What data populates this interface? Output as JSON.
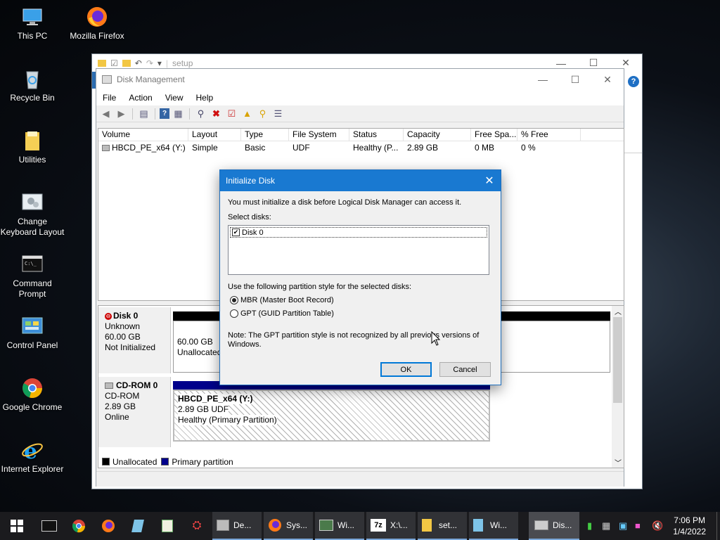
{
  "desktop": {
    "icons": [
      {
        "label": "This PC",
        "icon": "this-pc-icon"
      },
      {
        "label": "Mozilla Firefox",
        "icon": "firefox-icon"
      },
      {
        "label": "Recycle Bin",
        "icon": "recycle-bin-icon"
      },
      {
        "label": "Utilities",
        "icon": "folder-icon"
      },
      {
        "label": "Change Keyboard Layout",
        "icon": "keyboard-settings-icon"
      },
      {
        "label": "Command Prompt",
        "icon": "cmd-icon"
      },
      {
        "label": "Control Panel",
        "icon": "control-panel-icon"
      },
      {
        "label": "Google Chrome",
        "icon": "chrome-icon"
      },
      {
        "label": "Internet Explorer",
        "icon": "ie-icon"
      }
    ]
  },
  "explorer": {
    "path": "setup"
  },
  "disk_mgmt": {
    "title": "Disk Management",
    "menu": [
      "File",
      "Action",
      "View",
      "Help"
    ],
    "columns": [
      "Volume",
      "Layout",
      "Type",
      "File System",
      "Status",
      "Capacity",
      "Free Spa...",
      "% Free"
    ],
    "rows": [
      {
        "volume": "HBCD_PE_x64 (Y:)",
        "layout": "Simple",
        "type": "Basic",
        "fs": "UDF",
        "status": "Healthy (P...",
        "capacity": "2.89 GB",
        "free": "0 MB",
        "pct": "0 %"
      }
    ],
    "disks": [
      {
        "name": "Disk 0",
        "kind": "Unknown",
        "size": "60.00 GB",
        "state": "Not Initialized",
        "part_size": "60.00 GB",
        "part_state": "Unallocated"
      },
      {
        "name": "CD-ROM 0",
        "kind": "CD-ROM",
        "size": "2.89 GB",
        "state": "Online",
        "part_name": "HBCD_PE_x64  (Y:)",
        "part_size": "2.89 GB UDF",
        "part_state": "Healthy (Primary Partition)"
      }
    ],
    "legend": [
      "Unallocated",
      "Primary partition"
    ],
    "colors": {
      "unallocated": "#000000",
      "primary": "#00008b"
    }
  },
  "dialog": {
    "title": "Initialize Disk",
    "intro": "You must initialize a disk before Logical Disk Manager can access it.",
    "select_label": "Select disks:",
    "disk_item": "Disk 0",
    "style_label": "Use the following partition style for the selected disks:",
    "mbr": "MBR (Master Boot Record)",
    "gpt": "GPT (GUID Partition Table)",
    "note": "Note: The GPT partition style is not recognized by all previous versions of Windows.",
    "ok": "OK",
    "cancel": "Cancel"
  },
  "taskbar": {
    "items": [
      {
        "label": "De...",
        "icon": "device-manager-icon"
      },
      {
        "label": "Sys...",
        "icon": "firefox-icon"
      },
      {
        "label": "Wi...",
        "icon": "windows-app-icon"
      },
      {
        "label": "X:\\...",
        "icon": "7zip-icon"
      },
      {
        "label": "set...",
        "icon": "folder-icon"
      },
      {
        "label": "Wi...",
        "icon": "notepad-icon"
      },
      {
        "label": "Dis...",
        "icon": "disk-management-icon"
      }
    ],
    "time": "7:06 PM",
    "date": "1/4/2022"
  }
}
